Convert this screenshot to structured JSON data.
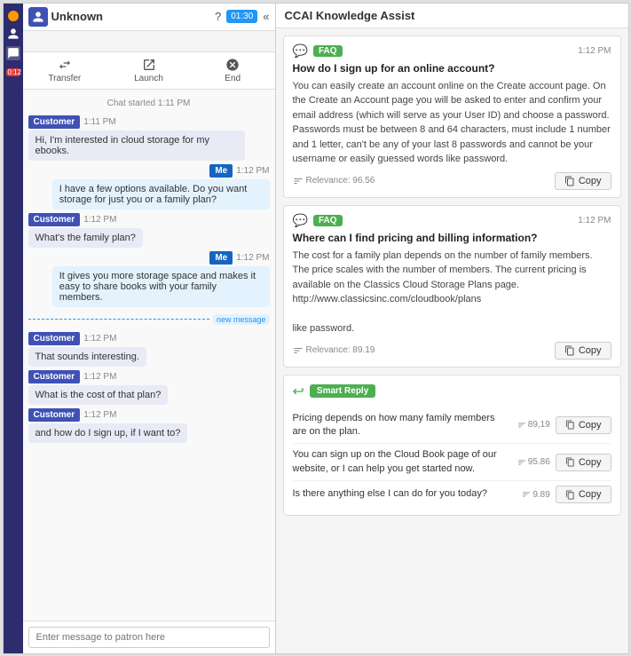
{
  "sidebar": {
    "dot_color": "#f90",
    "icons": [
      {
        "name": "person-icon",
        "symbol": "👤",
        "active": false
      },
      {
        "name": "chat-icon",
        "symbol": "💬",
        "active": true
      },
      {
        "name": "badge-icon",
        "symbol": "0:12",
        "active": false,
        "badge": true
      }
    ]
  },
  "chat": {
    "header": {
      "title": "Unknown",
      "timer": "01:30"
    },
    "search_placeholder": "",
    "toolbar": {
      "transfer_label": "Transfer",
      "launch_label": "Launch",
      "end_label": "End"
    },
    "chat_started": "Chat started 1:11 PM",
    "messages": [
      {
        "author": "Customer",
        "time": "1:11 PM",
        "text": "Hi, I'm interested in cloud storage for my ebooks.",
        "side": "customer"
      },
      {
        "author": "Me",
        "time": "1:12 PM",
        "text": "I have a few options available. Do you want storage for just you or a family plan?",
        "side": "me"
      },
      {
        "author": "Customer",
        "time": "1:12 PM",
        "text": "What's the family plan?",
        "side": "customer"
      },
      {
        "author": "Me",
        "time": "1:12 PM",
        "text": "It gives you more storage space and makes it easy to share books with your family members.",
        "side": "me"
      },
      {
        "author": "Customer",
        "time": "1:12 PM",
        "text": "That sounds interesting.",
        "side": "customer"
      },
      {
        "author": "Customer",
        "time": "1:12 PM",
        "text": "What is the cost of that plan?",
        "side": "customer"
      },
      {
        "author": "Customer",
        "time": "1:12 PM",
        "text": "and how do I sign up, if I want to?",
        "side": "customer"
      }
    ],
    "new_message_label": "new message",
    "input_placeholder": "Enter message to patron here"
  },
  "knowledge": {
    "title": "CCAI Knowledge Assist",
    "cards": [
      {
        "tag": "FAQ",
        "time": "1:12 PM",
        "title": "How do I sign up for an online account?",
        "body": "You can easily create an account online on the Create account page. On the Create an Account page you will be asked to enter and confirm your email address (which will serve as your User ID) and choose a password. Passwords must be between 8 and 64 characters, must include 1 number and 1 letter, can't be any of your last 8 passwords and cannot be your username or easily guessed words like password.",
        "relevance": "Relevance: 96.56",
        "copy_label": "Copy"
      },
      {
        "tag": "FAQ",
        "time": "1:12 PM",
        "title": "Where can I find pricing and billing information?",
        "body": "The cost for a family plan depends on the number of family members. The price scales with the number of members. The current pricing is available on the Classics Cloud Storage Plans page.\nhttp://www.classicsinc.com/cloudbook/plans\n\nlike password.",
        "relevance": "Relevance: 89.19",
        "copy_label": "Copy"
      }
    ],
    "smart_reply": {
      "label": "Smart Reply",
      "replies": [
        {
          "text": "Pricing depends on how many family members are on the plan.",
          "score": "89,19",
          "copy_label": "Copy"
        },
        {
          "text": "You can sign up on the Cloud Book page of our website, or I can help you get started now.",
          "score": "95.86",
          "copy_label": "Copy"
        },
        {
          "text": "Is there anything else I can do for you today?",
          "score": "9.89",
          "copy_label": "Copy"
        }
      ]
    }
  }
}
